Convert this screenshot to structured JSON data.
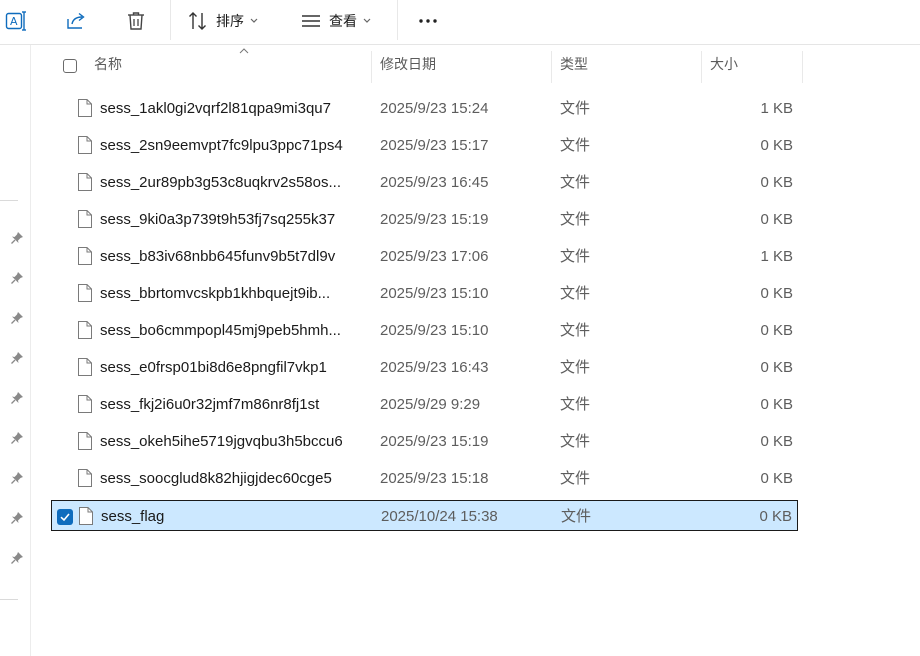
{
  "toolbar": {
    "sort_label": "排序",
    "view_label": "查看",
    "more_label": "···"
  },
  "columns": {
    "name": "名称",
    "modified": "修改日期",
    "type": "类型",
    "size": "大小"
  },
  "files": [
    {
      "name": "sess_1akl0gi2vqrf2l81qpa9mi3qu7",
      "modified": "2025/9/23 15:24",
      "type": "文件",
      "size": "1 KB"
    },
    {
      "name": "sess_2sn9eemvpt7fc9lpu3ppc71ps4",
      "modified": "2025/9/23 15:17",
      "type": "文件",
      "size": "0 KB"
    },
    {
      "name": "sess_2ur89pb3g53c8uqkrv2s58os...",
      "modified": "2025/9/23 16:45",
      "type": "文件",
      "size": "0 KB"
    },
    {
      "name": "sess_9ki0a3p739t9h53fj7sq255k37",
      "modified": "2025/9/23 15:19",
      "type": "文件",
      "size": "0 KB"
    },
    {
      "name": "sess_b83iv68nbb645funv9b5t7dl9v",
      "modified": "2025/9/23 17:06",
      "type": "文件",
      "size": "1 KB"
    },
    {
      "name": "sess_bbrtomvcskpb1khbquejt9ib...",
      "modified": "2025/9/23 15:10",
      "type": "文件",
      "size": "0 KB"
    },
    {
      "name": "sess_bo6cmmpopl45mj9peb5hmh...",
      "modified": "2025/9/23 15:10",
      "type": "文件",
      "size": "0 KB"
    },
    {
      "name": "sess_e0frsp01bi8d6e8pngfil7vkp1",
      "modified": "2025/9/23 16:43",
      "type": "文件",
      "size": "0 KB"
    },
    {
      "name": "sess_fkj2i6u0r32jmf7m86nr8fj1st",
      "modified": "2025/9/29 9:29",
      "type": "文件",
      "size": "0 KB"
    },
    {
      "name": "sess_okeh5ihe5719jgvqbu3h5bccu6",
      "modified": "2025/9/23 15:19",
      "type": "文件",
      "size": "0 KB"
    },
    {
      "name": "sess_soocglud8k82hjigjdec60cge5",
      "modified": "2025/9/23 15:18",
      "type": "文件",
      "size": "0 KB"
    },
    {
      "name": "sess_flag",
      "modified": "2025/10/24 15:38",
      "type": "文件",
      "size": "0 KB",
      "selected": true
    }
  ],
  "colors": {
    "selection_bg": "#cce8ff",
    "accent": "#0f6cbd"
  }
}
